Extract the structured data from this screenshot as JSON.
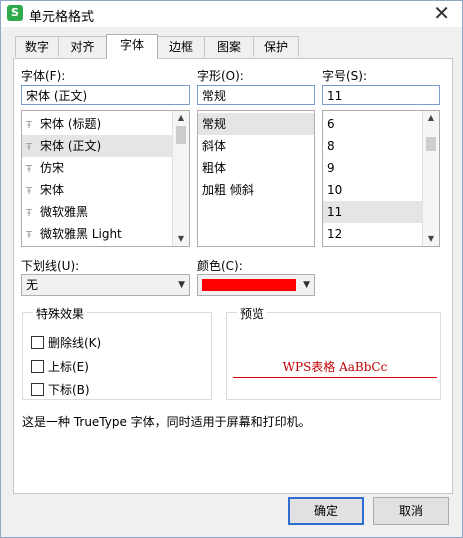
{
  "dialog": {
    "title": "单元格格式",
    "app_icon_letter": "S"
  },
  "tabs": [
    {
      "label": "数字"
    },
    {
      "label": "对齐"
    },
    {
      "label": "字体"
    },
    {
      "label": "边框"
    },
    {
      "label": "图案"
    },
    {
      "label": "保护"
    }
  ],
  "font": {
    "label": "字体(F):",
    "value": "宋体 (正文)",
    "items": [
      "宋体 (标题)",
      "宋体 (正文)",
      "仿宋",
      "宋体",
      "微软雅黑",
      "微软雅黑 Light"
    ],
    "selected_index": 1
  },
  "style": {
    "label": "字形(O):",
    "value": "常规",
    "items": [
      "常规",
      "斜体",
      "粗体",
      "加粗 倾斜"
    ],
    "selected_index": 0
  },
  "size": {
    "label": "字号(S):",
    "value": "11",
    "items": [
      "6",
      "8",
      "9",
      "10",
      "11",
      "12"
    ],
    "selected_index": 4
  },
  "underline": {
    "label": "下划线(U):",
    "value": "无"
  },
  "color": {
    "label": "颜色(C):",
    "swatch": "#ff0000"
  },
  "effects": {
    "legend": "特殊效果",
    "options": [
      {
        "label": "删除线(K)",
        "checked": false
      },
      {
        "label": "上标(E)",
        "checked": false
      },
      {
        "label": "下标(B)",
        "checked": false
      }
    ]
  },
  "preview": {
    "legend": "预览",
    "sample": "WPS表格  AaBbCc"
  },
  "description": "这是一种 TrueType 字体，同时适用于屏幕和打印机。",
  "buttons": {
    "ok": "确定",
    "cancel": "取消"
  },
  "colors": {
    "accent": "#2f6ed1",
    "preview_text": "#c00000",
    "underline": "#e00000"
  }
}
